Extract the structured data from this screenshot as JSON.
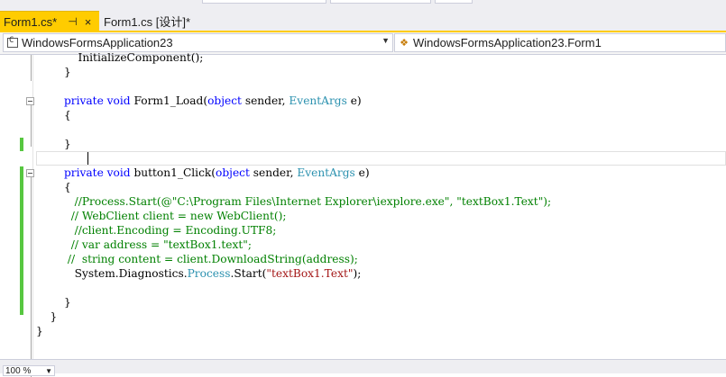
{
  "tabs": [
    {
      "label": "Form1.cs*",
      "pin_icon": "⊣",
      "close_icon": "×",
      "active": true
    },
    {
      "label": "Form1.cs [设计]*",
      "active": false
    }
  ],
  "navigation": {
    "project_dropdown": {
      "value": "WindowsFormsApplication23",
      "icon": "csharp-project-icon"
    },
    "class_dropdown": {
      "value": "WindowsFormsApplication23.Form1",
      "icon": "class-icon"
    }
  },
  "code": {
    "lines": [
      {
        "indent": "            ",
        "text": "InitializeComponent();"
      },
      {
        "indent": "        ",
        "text": "}"
      },
      {
        "indent": "",
        "text": ""
      },
      {
        "indent": "        ",
        "kw1": "private void ",
        "name": "Form1_Load(",
        "kw2": "object",
        "rest1": " sender, ",
        "type": "EventArgs",
        "rest2": " e)"
      },
      {
        "indent": "        ",
        "text": "{"
      },
      {
        "indent": "",
        "text": ""
      },
      {
        "indent": "        ",
        "text": "}"
      },
      {
        "indent": "",
        "text": ""
      },
      {
        "indent": "        ",
        "kw1": "private void ",
        "name": "button1_Click(",
        "kw2": "object",
        "rest1": " sender, ",
        "type": "EventArgs",
        "rest2": " e)"
      },
      {
        "indent": "        ",
        "text": "{"
      },
      {
        "indent": "           ",
        "comment": "//Process.Start(@\"C:\\Program Files\\Internet Explorer\\iexplore.exe\", \"textBox1.Text\");"
      },
      {
        "indent": "          ",
        "comment": "// WebClient client = new WebClient();"
      },
      {
        "indent": "           ",
        "comment": "//client.Encoding = Encoding.UTF8;"
      },
      {
        "indent": "          ",
        "comment": "// var address = \"textBox1.text\";"
      },
      {
        "indent": "         ",
        "comment": "//  string content = client.DownloadString(address);"
      },
      {
        "indent": "           ",
        "pre": "System.Diagnostics.",
        "type": "Process",
        "mid": ".Start(",
        "str": "\"textBox1.Text\"",
        "post": ");"
      },
      {
        "indent": "",
        "text": ""
      },
      {
        "indent": "        ",
        "text": "}"
      },
      {
        "indent": "    ",
        "text": "}"
      },
      {
        "indent": "",
        "text": "}"
      }
    ]
  },
  "zoom": {
    "value": "100 %"
  },
  "colors": {
    "active_tab": "#ffcc00",
    "keyword": "#0000ff",
    "type": "#2b91af",
    "comment": "#008000",
    "string": "#a31515",
    "change_bar": "#57c740"
  }
}
